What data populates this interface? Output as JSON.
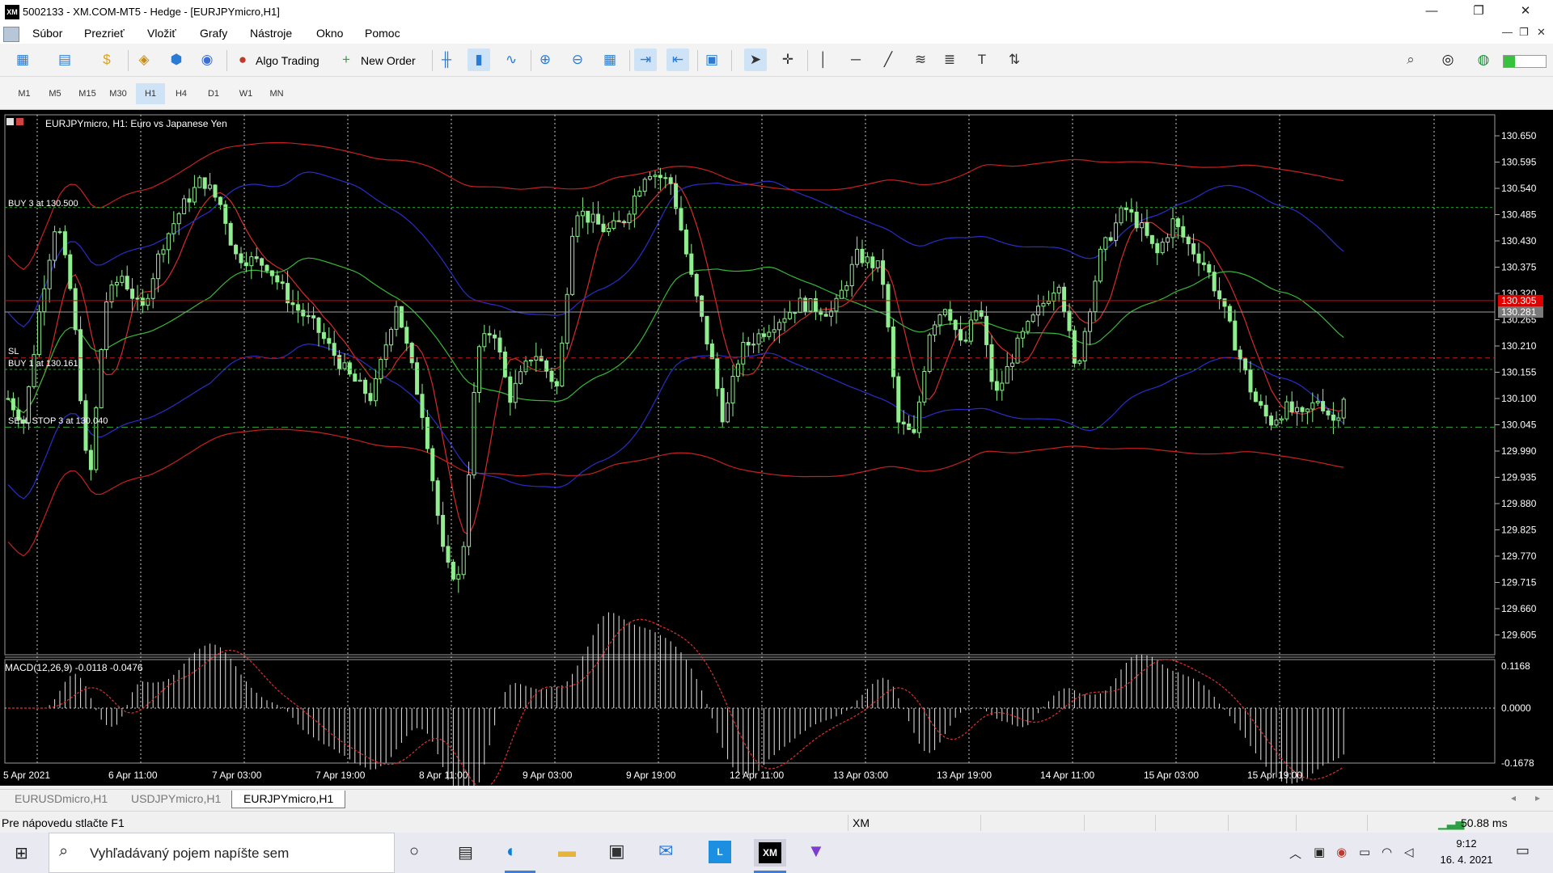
{
  "window": {
    "title": "5002133 - XM.COM-MT5 - Hedge - [EURJPYmicro,H1]",
    "logo_text": "XM",
    "controls": [
      "—",
      "❐",
      "✕"
    ]
  },
  "menu": {
    "items": [
      "Súbor",
      "Prezrieť",
      "Vložiť",
      "Grafy",
      "Nástroje",
      "Okno",
      "Pomoc"
    ],
    "mdi_controls": [
      "—",
      "❐",
      "✕"
    ]
  },
  "toolbar": {
    "algo_trading": "Algo Trading",
    "new_order": "New Order"
  },
  "timeframes": {
    "items": [
      "M1",
      "M5",
      "M15",
      "M30",
      "H1",
      "H4",
      "D1",
      "W1",
      "MN"
    ],
    "active": "H1"
  },
  "chart": {
    "header": "EURJPYmicro, H1:  Euro vs Japanese Yen",
    "price_labels": [
      "130.650",
      "130.595",
      "130.540",
      "130.485",
      "130.430",
      "130.375",
      "130.320",
      "130.265",
      "130.210",
      "130.155",
      "130.100",
      "130.045",
      "129.990",
      "129.935",
      "129.880",
      "129.825",
      "129.770",
      "129.715",
      "129.660",
      "129.605"
    ],
    "current_bid": "130.305",
    "current_ask": "130.281",
    "order_labels": {
      "buy_high": "BUY 3 at 130.500",
      "sl": "SL",
      "buy_low": "BUY 1 at 130.161",
      "sell_stop": "SELL STOP 3 at 130.040"
    },
    "macd_header": "MACD(12,26,9) -0.0118 -0.0476",
    "macd_labels": [
      "0.1168",
      "0.0000",
      "-0.1678"
    ],
    "time_labels": [
      "5 Apr 2021",
      "6 Apr 11:00",
      "7 Apr 03:00",
      "7 Apr 19:00",
      "8 Apr 11:00",
      "9 Apr 03:00",
      "9 Apr 19:00",
      "12 Apr 11:00",
      "13 Apr 03:00",
      "13 Apr 19:00",
      "14 Apr 11:00",
      "15 Apr 03:00",
      "15 Apr 19:00"
    ],
    "colors": {
      "background": "#000000",
      "bull": "#90ee90",
      "bear": "#90ee90",
      "grid": "#c0c0c0"
    }
  },
  "chart_tabs": [
    "EURUSDmicro,H1",
    "USDJPYmicro,H1",
    "EURJPYmicro,H1"
  ],
  "active_chart_tab": "EURJPYmicro,H1",
  "status": {
    "help": "Pre nápovedu stlačte F1",
    "server": "XM",
    "ping": "50.88 ms"
  },
  "taskbar": {
    "search_placeholder": "Vyhľadávaný pojem napíšte sem",
    "time": "9:12",
    "date": "16. 4. 2021"
  }
}
